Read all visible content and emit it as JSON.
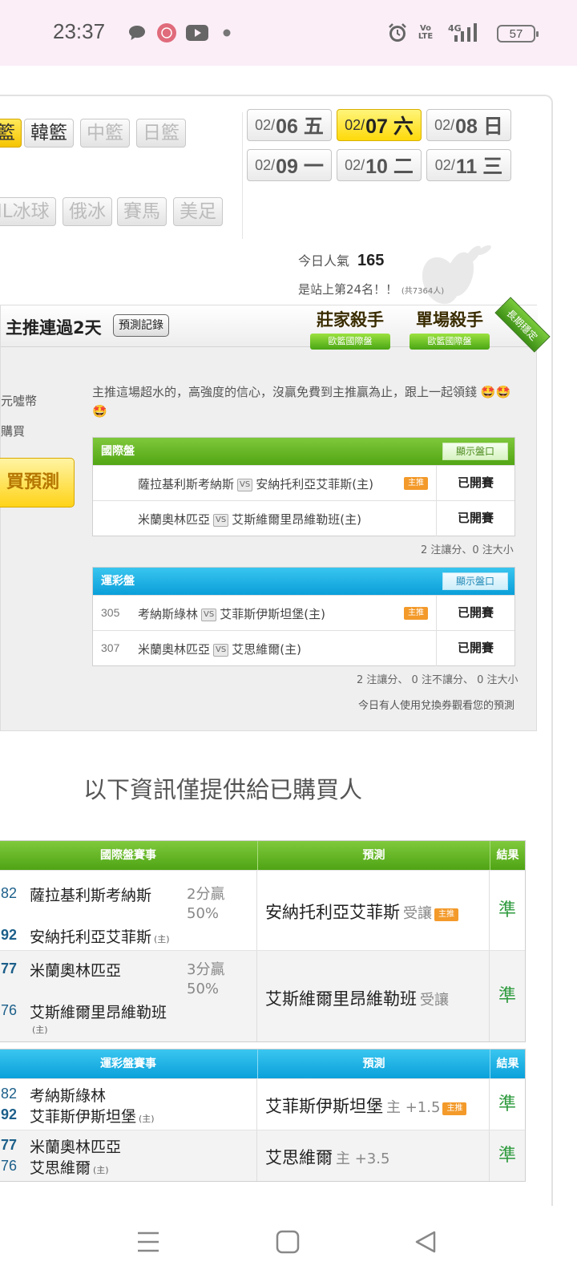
{
  "status_bar": {
    "time": "23:37",
    "network": "4G",
    "battery": "57"
  },
  "sports_tabs": [
    {
      "label": "籃",
      "state": "selected"
    },
    {
      "label": "韓籃",
      "state": "enabled"
    },
    {
      "label": "中籃",
      "state": "disabled"
    },
    {
      "label": "日籃",
      "state": "disabled"
    },
    {
      "label": "IL冰球",
      "state": "disabled"
    },
    {
      "label": "俄冰",
      "state": "disabled"
    },
    {
      "label": "賽馬",
      "state": "disabled"
    },
    {
      "label": "美足",
      "state": "disabled"
    }
  ],
  "dates": [
    {
      "md": "02/",
      "day": "06 五",
      "selected": false
    },
    {
      "md": "02/",
      "day": "07 六",
      "selected": true
    },
    {
      "md": "02/",
      "day": "08 日",
      "selected": false
    },
    {
      "md": "02/",
      "day": "09 一",
      "selected": false
    },
    {
      "md": "02/",
      "day": "10 二",
      "selected": false
    },
    {
      "md": "02/",
      "day": "11 三",
      "selected": false
    }
  ],
  "popularity": {
    "label": "今日人氣",
    "value": "165",
    "rank_text": "是站上第24名！！",
    "total": "(共7364人)"
  },
  "panel": {
    "title": "主推連過2天",
    "record_button": "預測記錄",
    "badge1": {
      "title": "莊家殺手",
      "sub": "歐籃國際盤"
    },
    "badge2": {
      "title": "單場殺手",
      "sub": "歐籃國際盤"
    },
    "ribbon": "長期穩定",
    "left_text1": "元噓幣",
    "left_text2": "購買",
    "buy_button": "買預測",
    "description": "主推這場超水的，高強度的信心，沒贏免費到主推贏為止，跟上一起領錢 🤩🤩🤩"
  },
  "intl_table": {
    "header": "國際盤",
    "show_button": "顯示盤口",
    "rows": [
      {
        "num": "",
        "home": "薩拉基利斯考納斯",
        "vs": "VS",
        "away": "安納托利亞艾菲斯(主)",
        "main": "主推",
        "status": "已開賽"
      },
      {
        "num": "",
        "home": "米蘭奧林匹亞",
        "vs": "VS",
        "away": "艾斯維爾里昂維勒班(主)",
        "main": "",
        "status": "已開賽"
      }
    ],
    "summary": "2 注讓分、0 注大小"
  },
  "lottery_table": {
    "header": "運彩盤",
    "show_button": "顯示盤口",
    "rows": [
      {
        "num": "305",
        "home": "考納斯綠林",
        "vs": "VS",
        "away": "艾菲斯伊斯坦堡(主)",
        "main": "主推",
        "status": "已開賽"
      },
      {
        "num": "307",
        "home": "米蘭奧林匹亞",
        "vs": "VS",
        "away": "艾思維爾(主)",
        "main": "",
        "status": "已開賽"
      }
    ],
    "summary": "2 注讓分、 0 注不讓分、 0 注大小",
    "voucher_note": "今日有人使用兌換券觀看您的預測"
  },
  "info_title": "以下資訊僅提供給已購買人",
  "results_intl": {
    "headers": [
      "國際盤賽事",
      "預測",
      "結果"
    ],
    "rows": [
      {
        "odd1": "82",
        "team1": "薩拉基利斯考納斯",
        "odd2": "92",
        "team2": "安納托利亞艾菲斯",
        "host": "(主)",
        "score1": "2分贏",
        "score2": "50%",
        "pred": "安納托利亞艾菲斯",
        "pred_extra": "受讓",
        "main": "主推",
        "result": "準"
      },
      {
        "odd1": "77",
        "team1": "米蘭奧林匹亞",
        "odd2": "76",
        "team2": "艾斯維爾里昂維勒班",
        "host": "(主)",
        "score1": "3分贏",
        "score2": "50%",
        "pred": "艾斯維爾里昂維勒班",
        "pred_extra": "受讓",
        "main": "",
        "result": "準"
      }
    ]
  },
  "results_lottery": {
    "headers": [
      "運彩盤賽事",
      "預測",
      "結果"
    ],
    "rows": [
      {
        "odd1": "82",
        "team1": "考納斯綠林",
        "odd2": "92",
        "team2": "艾菲斯伊斯坦堡",
        "host": "(主)",
        "pred": "艾菲斯伊斯坦堡",
        "pred_extra": "主 +1.5",
        "main": "主推",
        "result": "準"
      },
      {
        "odd1": "77",
        "team1": "米蘭奧林匹亞",
        "odd2": "76",
        "team2": "艾思維爾",
        "host": "(主)",
        "pred": "艾思維爾",
        "pred_extra": "主 +3.5",
        "main": "",
        "result": "準"
      }
    ]
  },
  "icons": [
    "chat-icon",
    "app-icon",
    "youtube-icon",
    "dot-icon",
    "alarm-icon",
    "volte-icon",
    "signal-icon",
    "battery-icon",
    "menu-icon",
    "home-icon",
    "back-icon"
  ]
}
